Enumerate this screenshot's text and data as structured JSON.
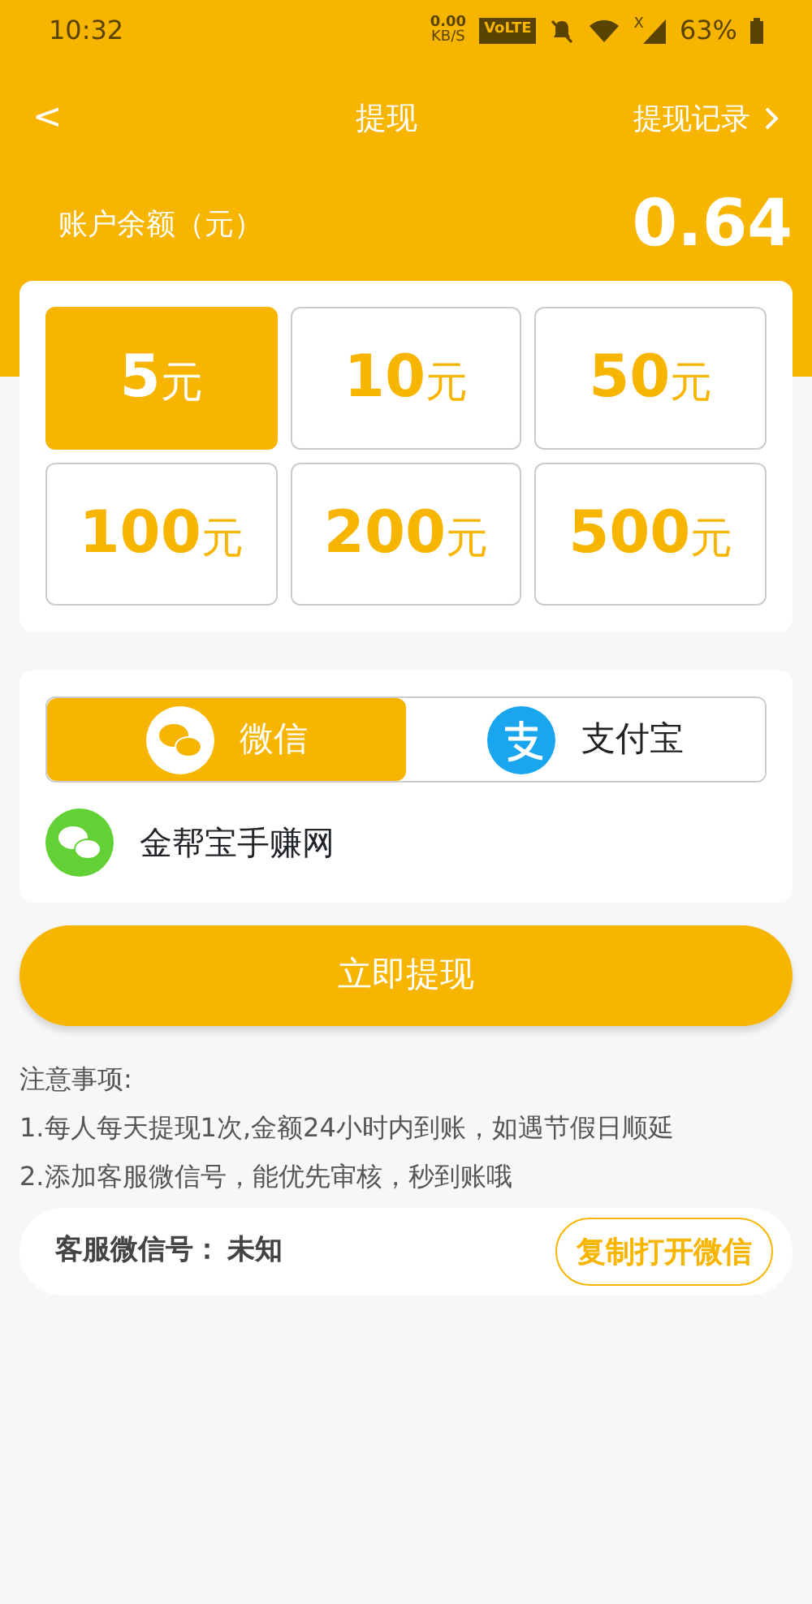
{
  "status_bar": {
    "time": "10:32",
    "net_speed": "0.00",
    "net_unit": "KB/S",
    "volte": "VoLTE",
    "signal_mark": "X",
    "battery": "63%"
  },
  "nav": {
    "back": "<",
    "title": "提现",
    "history": "提现记录"
  },
  "balance": {
    "label": "账户余额（元）",
    "value": "0.64"
  },
  "amounts": [
    {
      "value": "5",
      "unit": "元",
      "selected": true
    },
    {
      "value": "10",
      "unit": "元",
      "selected": false
    },
    {
      "value": "50",
      "unit": "元",
      "selected": false
    },
    {
      "value": "100",
      "unit": "元",
      "selected": false
    },
    {
      "value": "200",
      "unit": "元",
      "selected": false
    },
    {
      "value": "500",
      "unit": "元",
      "selected": false
    }
  ],
  "pay_tabs": [
    {
      "kind": "wechat",
      "label": "微信",
      "selected": true
    },
    {
      "kind": "alipay",
      "label": "支付宝",
      "selected": false
    }
  ],
  "account": {
    "name": "金帮宝手赚网"
  },
  "withdraw_button": "立即提现",
  "notes": {
    "title": "注意事项:",
    "lines": [
      "1.每人每天提现1次,金额24小时内到账，如遇节假日顺延",
      "2.添加客服微信号，能优先审核，秒到账哦"
    ]
  },
  "service": {
    "label": "客服微信号：",
    "value": "未知",
    "button": "复制打开微信"
  }
}
